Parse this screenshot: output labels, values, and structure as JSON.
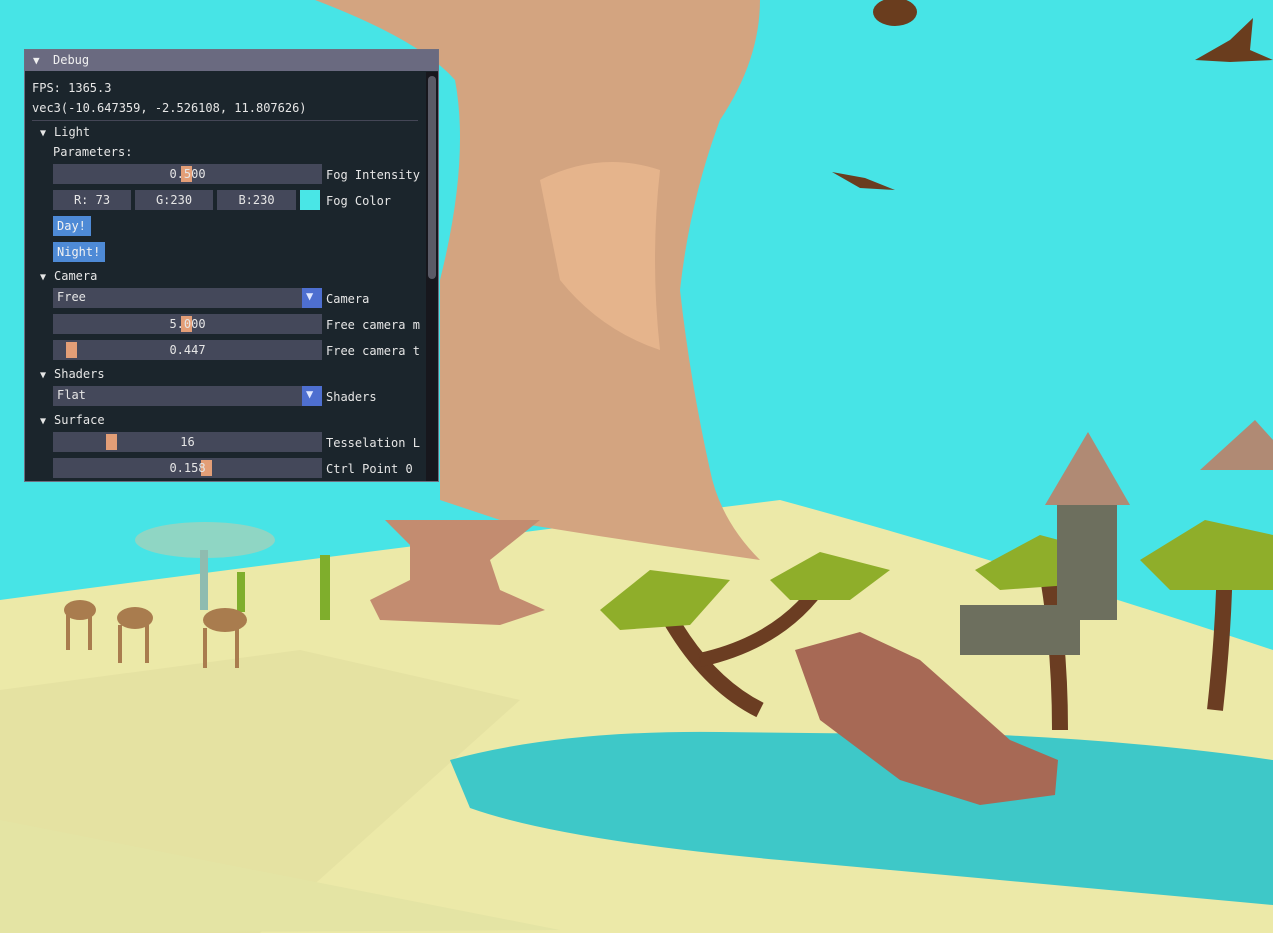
{
  "window": {
    "title": "Debug",
    "fps": "FPS: 1365.3",
    "position": "vec3(-10.647359, -2.526108, 11.807626)"
  },
  "light": {
    "header": "Light",
    "params_label": "Parameters:",
    "fog_intensity": {
      "value": "0.500",
      "label": "Fog Intensity",
      "fraction": 0.5
    },
    "fog_color": {
      "r": "R: 73",
      "g": "G:230",
      "b": "B:230",
      "label": "Fog Color",
      "swatch": "#49e6e6"
    },
    "day_button": "Day!",
    "night_button": "Night!"
  },
  "camera": {
    "header": "Camera",
    "mode": {
      "selected": "Free",
      "label": "Camera"
    },
    "move_speed": {
      "value": "5.000",
      "label": "Free camera m",
      "fraction": 0.5
    },
    "turn_speed": {
      "value": "0.447",
      "label": "Free camera t",
      "fraction": 0.07
    }
  },
  "shaders": {
    "header": "Shaders",
    "mode": {
      "selected": "Flat",
      "label": "Shaders"
    }
  },
  "surface": {
    "header": "Surface",
    "tesselation": {
      "value": "16",
      "label": "Tesselation L",
      "fraction": 0.22
    },
    "ctrl_point": {
      "value": "0.158",
      "label": "Ctrl Point 0",
      "fraction": 0.58
    }
  },
  "colors": {
    "sky": "#47e4e6",
    "sand": "#ece9a8",
    "water": "#3ec8c8",
    "panel_bg": "#18181f",
    "slider_grab": "#f5a77a",
    "button": "#4e8ad6"
  }
}
